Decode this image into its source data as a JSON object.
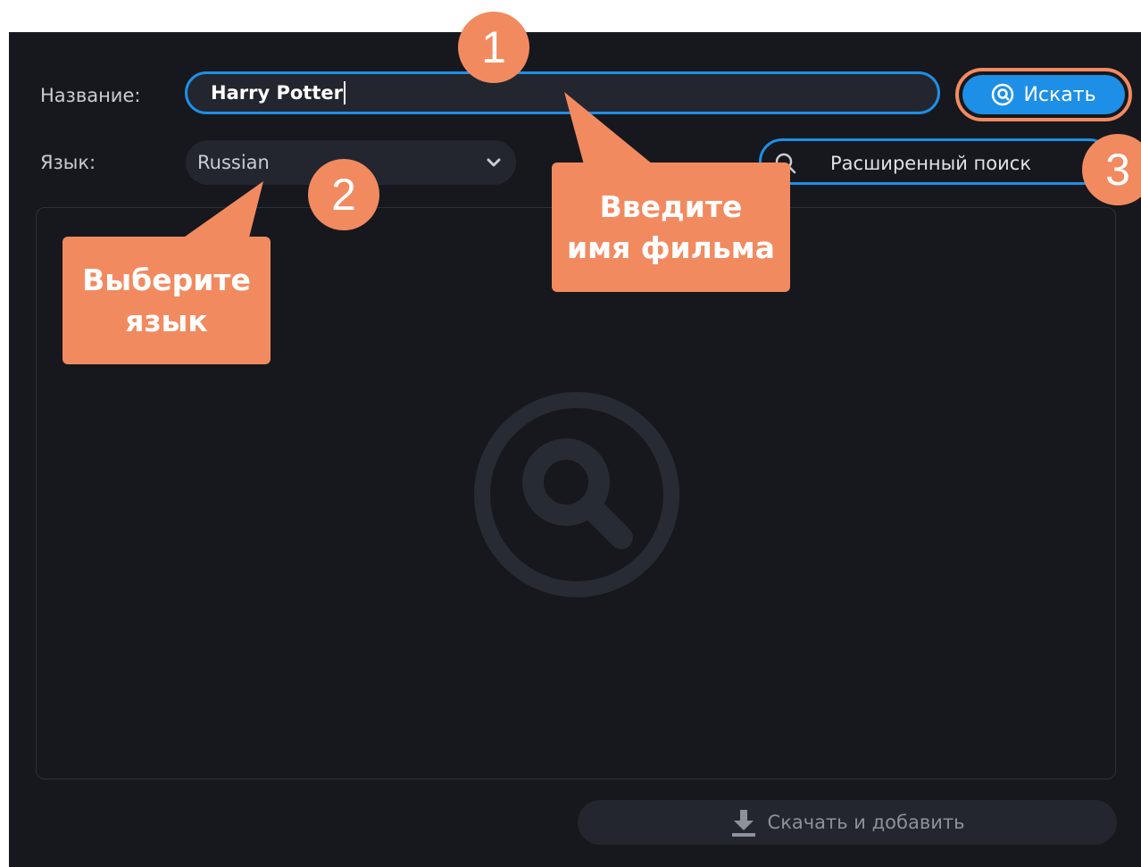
{
  "form": {
    "title_label": "Название:",
    "title_value": "Harry Potter",
    "search_button_label": "Искать",
    "language_label": "Язык:",
    "language_value": "Russian",
    "advanced_search_label": "Расширенный поиск",
    "download_button_label": "Скачать и добавить"
  },
  "annotations": {
    "badges": [
      "1",
      "2",
      "3"
    ],
    "callout_title": {
      "line1": "Введите",
      "line2": "имя фильма"
    },
    "callout_language": {
      "line1": "Выберите",
      "line2": "язык"
    }
  },
  "colors": {
    "background": "#16181d",
    "field": "#23262e",
    "accent_blue": "#1e8fe6",
    "annotation_orange": "#f28a60"
  },
  "icons": {
    "search_button": "at-search-icon",
    "language_dropdown": "chevron-down-icon",
    "advanced_search": "search-icon",
    "empty_state": "magnifier-icon",
    "download": "download-icon"
  }
}
